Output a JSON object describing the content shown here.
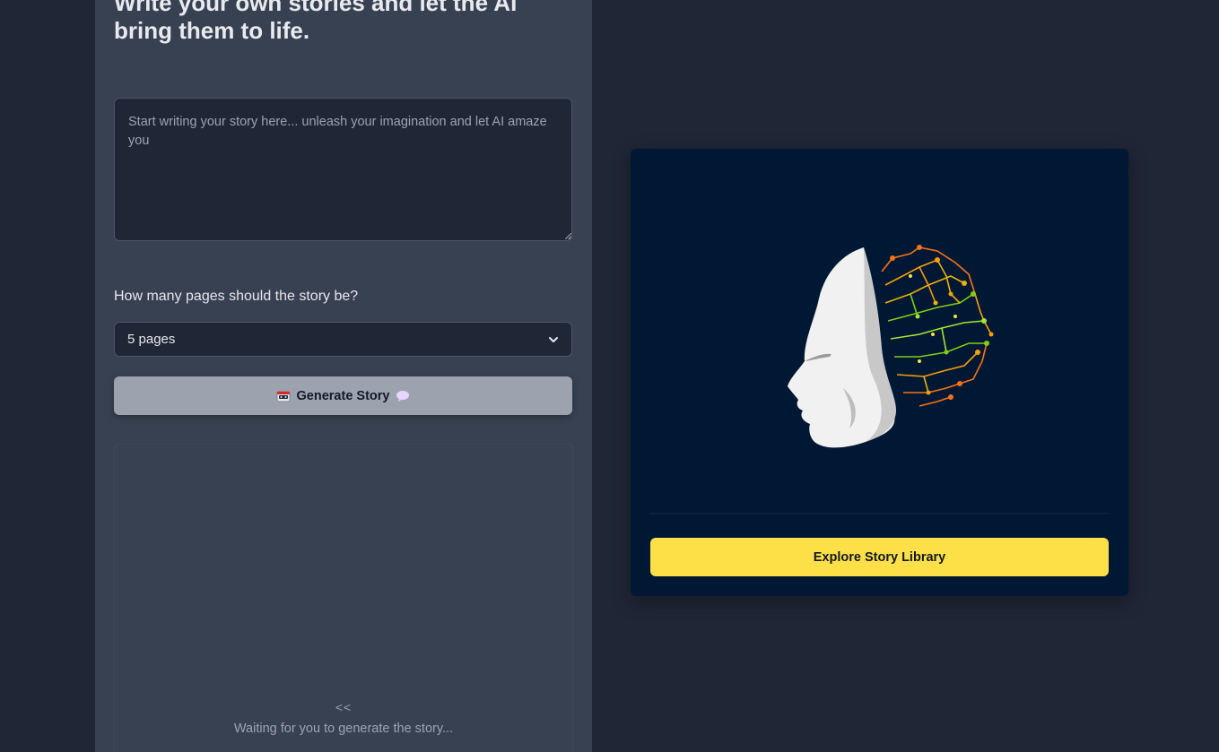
{
  "composer": {
    "headline": "Write your own stories and let the AI bring them to life.",
    "story_placeholder": "Start writing your story here... unleash your imagination and let AI amaze you",
    "pages_label": "How many pages should the story be?",
    "pages_selected": "5 pages",
    "generate_label": "Generate Story",
    "generate_icon_left": "robot-icon",
    "generate_icon_right": "speech-bubble-icon"
  },
  "output": {
    "arrows": "<<",
    "waiting_text": "Waiting for you to generate the story..."
  },
  "library": {
    "hero_image": "ai-head-circuit-brain-illustration",
    "explore_label": "Explore Story Library"
  },
  "colors": {
    "page_bg": "#1f2636",
    "panel_bg": "#384152",
    "card_bg": "#001833",
    "explore_button": "#fde047",
    "generate_button": "#9ca3af"
  }
}
